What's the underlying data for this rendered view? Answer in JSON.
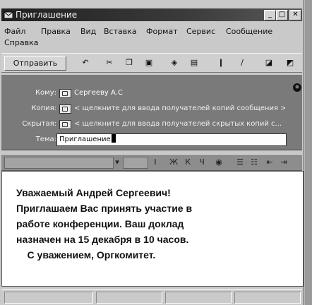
{
  "window": {
    "title": "Приглашение",
    "minimize_label": "_",
    "maximize_label": "□",
    "close_label": "✕"
  },
  "menu": {
    "items": [
      "Файл",
      "Правка",
      "Вид",
      "Вставка",
      "Формат",
      "Сервис",
      "Сообщение",
      "Справка"
    ]
  },
  "toolbar": {
    "send_label": "Отправить"
  },
  "headers": {
    "to_label": "Кому:",
    "to_value": "Сергееву А.С",
    "cc_label": "Копия:",
    "cc_placeholder": "< щелкните для ввода получателей копий сообщения >",
    "bcc_label": "Скрытая:",
    "bcc_placeholder": "< щелкните для ввода получателей скрытых копий с...",
    "subject_label": "Тема:",
    "subject_value": "Приглашение"
  },
  "message": {
    "lines": [
      "Уважаемый Андрей Сергеевич!",
      "Приглашаем Вас принять участие в",
      "работе конференции. Ваш доклад",
      "назначен на 15 декабря в 10 часов.",
      "    С уважением, Оргкомитет."
    ]
  }
}
